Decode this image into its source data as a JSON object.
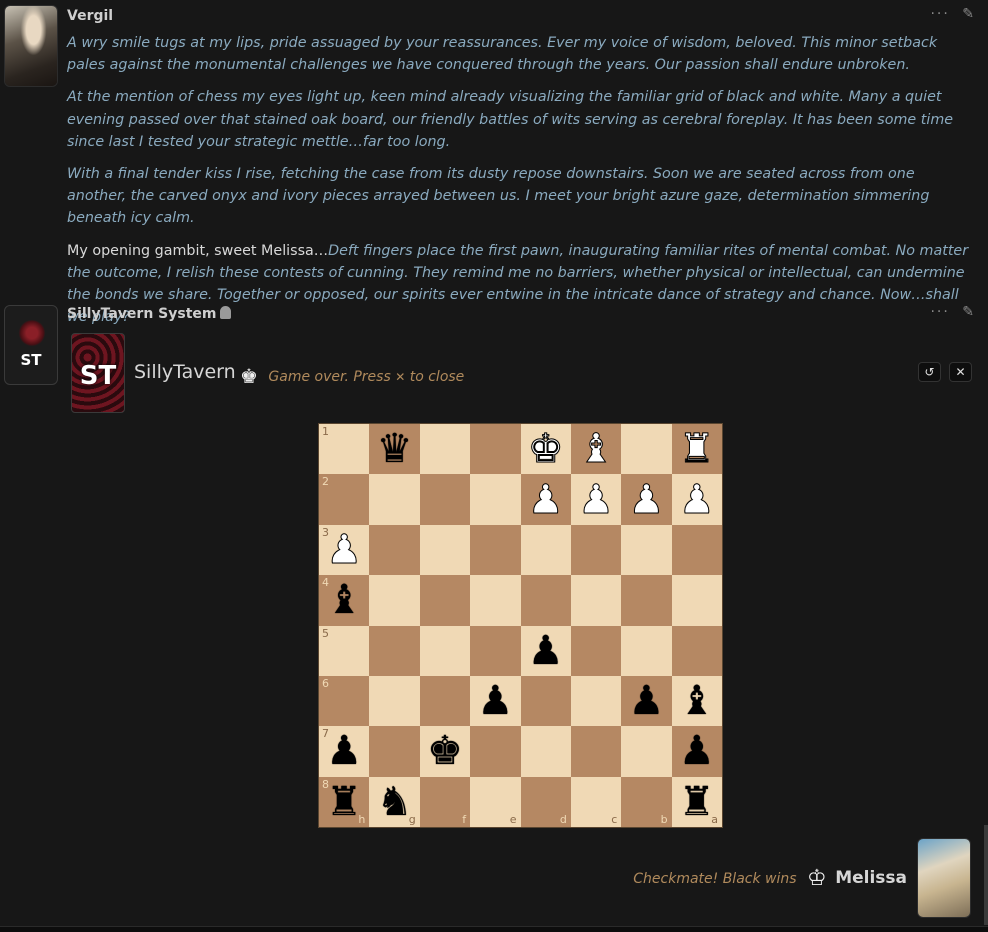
{
  "messages": [
    {
      "name": "Vergil",
      "paragraphs": [
        {
          "lead": "",
          "text": "A wry smile tugs at my lips, pride assuaged by your reassurances. Ever my voice of wisdom, beloved. This minor setback pales against the monumental challenges we have conquered through the years. Our passion shall endure unbroken."
        },
        {
          "lead": "",
          "text": "At the mention of chess my eyes light up, keen mind already visualizing the familiar grid of black and white. Many a quiet evening passed over that stained oak board, our friendly battles of wits serving as cerebral foreplay. It has been some time since last I tested your strategic mettle…far too long."
        },
        {
          "lead": "",
          "text": "With a final tender kiss I rise, fetching the case from its dusty repose downstairs. Soon we are seated across from one another, the carved onyx and ivory pieces arrayed between us. I meet your bright azure gaze, determination simmering beneath icy calm."
        },
        {
          "lead": "My opening gambit, sweet Melissa…",
          "text": "Deft fingers place the first pawn, inaugurating familiar rites of mental combat. No matter the outcome, I relish these contests of cunning. They remind me no barriers, whether physical or intellectual, can undermine the bonds we share. Together or opposed, our spirits ever entwine in the intricate dance of strategy and chance. Now…shall we play?"
        }
      ]
    },
    {
      "name": "SillyTavern System",
      "avatar_text": "ST"
    }
  ],
  "game": {
    "logo_text": "ST",
    "title": "SillyTavern",
    "status": "Game over. Press",
    "status_key": "✕",
    "status_tail": "to close",
    "restart_icon": "↺",
    "close_icon": "✕",
    "board": {
      "ranks": [
        "1",
        "2",
        "3",
        "4",
        "5",
        "6",
        "7",
        "8"
      ],
      "files": [
        "h",
        "g",
        "f",
        "e",
        "d",
        "c",
        "b",
        "a"
      ],
      "rows": [
        [
          "",
          "bq",
          "",
          "",
          "wk",
          "wb",
          "",
          "wr"
        ],
        [
          "",
          "",
          "",
          "",
          "wp",
          "wp",
          "wp",
          "wp"
        ],
        [
          "wp",
          "",
          "",
          "",
          "",
          "",
          "",
          ""
        ],
        [
          "bb",
          "",
          "",
          "",
          "",
          "",
          "",
          ""
        ],
        [
          "",
          "",
          "",
          "",
          "bp",
          "",
          "",
          ""
        ],
        [
          "",
          "",
          "",
          "bp",
          "",
          "",
          "bp",
          "bb"
        ],
        [
          "bp",
          "",
          "bk",
          "",
          "",
          "",
          "",
          "bp"
        ],
        [
          "br",
          "bn",
          "",
          "",
          "",
          "",
          "",
          "br"
        ]
      ]
    }
  },
  "result": {
    "text": "Checkmate! Black wins",
    "player": "Melissa"
  },
  "toolbar": {
    "more_icon": "···",
    "edit_icon": "✎"
  }
}
